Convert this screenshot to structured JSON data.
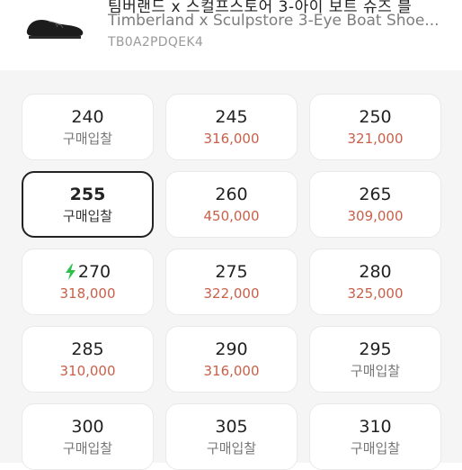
{
  "product": {
    "title_cut": "팀버랜드 x 스컬프스토어 3-아이 보트 슈즈 블",
    "name": "Timberland x Sculpstore 3-Eye Boat Shoe...",
    "code": "TB0A2PDQEK4"
  },
  "colors": {
    "price": "#c8604a",
    "bid": "#777777",
    "selected_border": "#222222",
    "bolt": "#2fbf4a"
  },
  "sizes": [
    {
      "size": "240",
      "price": "구매입찰",
      "has_price": false,
      "selected": false,
      "fast": false
    },
    {
      "size": "245",
      "price": "316,000",
      "has_price": true,
      "selected": false,
      "fast": false
    },
    {
      "size": "250",
      "price": "321,000",
      "has_price": true,
      "selected": false,
      "fast": false
    },
    {
      "size": "255",
      "price": "구매입찰",
      "has_price": false,
      "selected": true,
      "fast": false
    },
    {
      "size": "260",
      "price": "450,000",
      "has_price": true,
      "selected": false,
      "fast": false
    },
    {
      "size": "265",
      "price": "309,000",
      "has_price": true,
      "selected": false,
      "fast": false
    },
    {
      "size": "270",
      "price": "318,000",
      "has_price": true,
      "selected": false,
      "fast": true
    },
    {
      "size": "275",
      "price": "322,000",
      "has_price": true,
      "selected": false,
      "fast": false
    },
    {
      "size": "280",
      "price": "325,000",
      "has_price": true,
      "selected": false,
      "fast": false
    },
    {
      "size": "285",
      "price": "310,000",
      "has_price": true,
      "selected": false,
      "fast": false
    },
    {
      "size": "290",
      "price": "316,000",
      "has_price": true,
      "selected": false,
      "fast": false
    },
    {
      "size": "295",
      "price": "구매입찰",
      "has_price": false,
      "selected": false,
      "fast": false
    },
    {
      "size": "300",
      "price": "구매입찰",
      "has_price": false,
      "selected": false,
      "fast": false
    },
    {
      "size": "305",
      "price": "구매입찰",
      "has_price": false,
      "selected": false,
      "fast": false
    },
    {
      "size": "310",
      "price": "구매입찰",
      "has_price": false,
      "selected": false,
      "fast": false
    }
  ]
}
